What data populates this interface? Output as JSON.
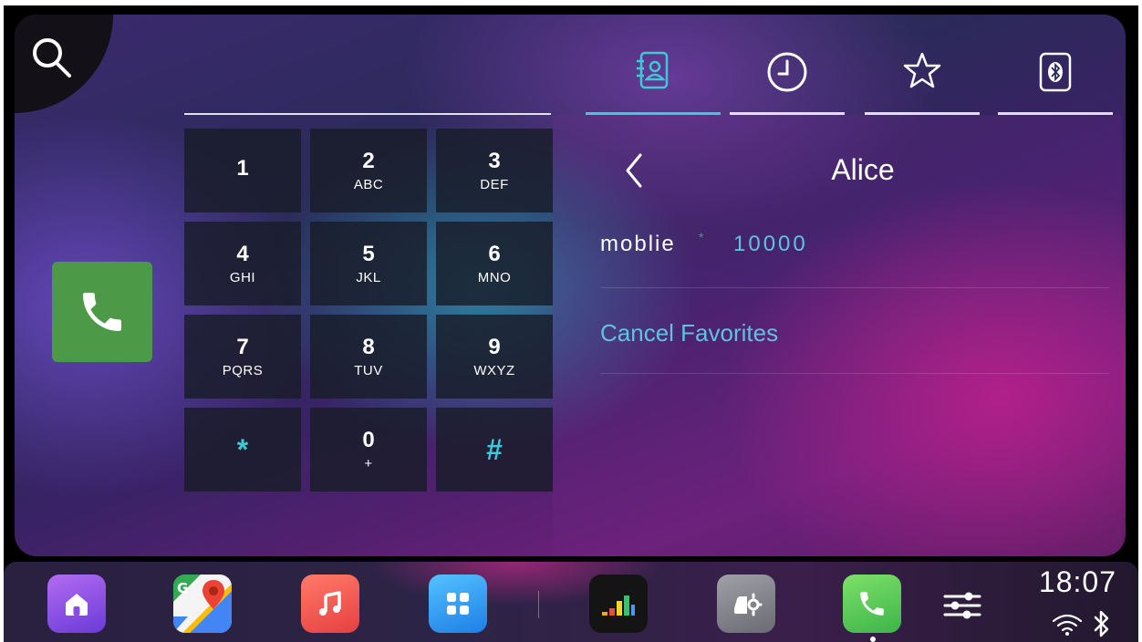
{
  "dialer": {
    "number": "",
    "keys": [
      {
        "digit": "1",
        "letters": ""
      },
      {
        "digit": "2",
        "letters": "ABC"
      },
      {
        "digit": "3",
        "letters": "DEF"
      },
      {
        "digit": "4",
        "letters": "GHI"
      },
      {
        "digit": "5",
        "letters": "JKL"
      },
      {
        "digit": "6",
        "letters": "MNO"
      },
      {
        "digit": "7",
        "letters": "PQRS"
      },
      {
        "digit": "8",
        "letters": "TUV"
      },
      {
        "digit": "9",
        "letters": "WXYZ"
      },
      {
        "digit": "*",
        "letters": ""
      },
      {
        "digit": "0",
        "letters": "+"
      },
      {
        "digit": "#",
        "letters": ""
      }
    ]
  },
  "tabs": [
    {
      "icon": "contacts-book-icon",
      "active": true
    },
    {
      "icon": "clock-recents-icon",
      "active": false
    },
    {
      "icon": "star-favorites-icon",
      "active": false
    },
    {
      "icon": "bluetooth-phone-icon",
      "active": false
    }
  ],
  "contact": {
    "name": "Alice",
    "number_label": "moblie",
    "number_star": "*",
    "number_value": "10000",
    "cancel_favorites_label": "Cancel Favorites"
  },
  "dock": {
    "apps": [
      "home",
      "google-maps",
      "music",
      "apps-grid",
      "deezer",
      "car-settings",
      "phone"
    ],
    "active_app": "phone",
    "time": "18:07"
  },
  "colors": {
    "accent_cyan": "#3ec9d6",
    "link_blue": "#5fc3df",
    "call_green": "#4c9a47"
  }
}
